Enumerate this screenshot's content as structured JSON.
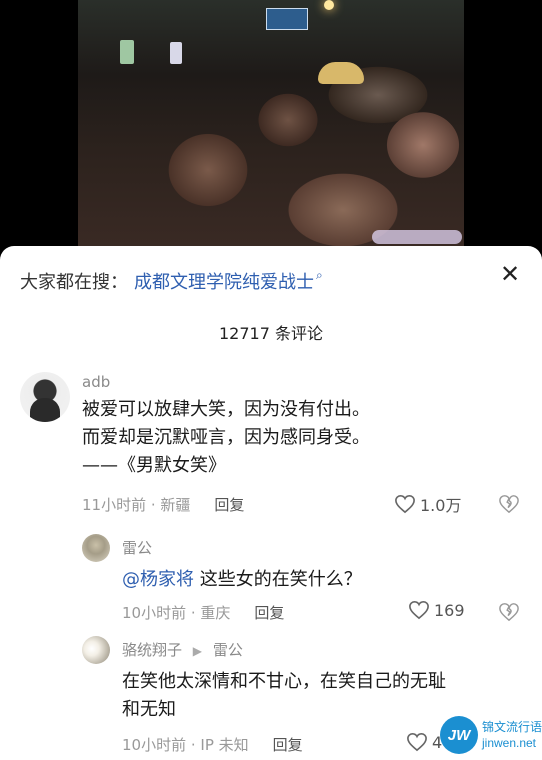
{
  "search": {
    "prefix": "大家都在搜：",
    "query": "成都文理学院纯爱战士",
    "icon": "search-icon"
  },
  "comments_count": "12717 条评论",
  "comments": [
    {
      "username": "adb",
      "lines": [
        "被爱可以放肆大笑，因为没有付出。",
        "而爱却是沉默哑言，因为感同身受。",
        "——《男默女笑》"
      ],
      "time_location": "11小时前 · 新疆",
      "reply_label": "回复",
      "likes": "1.0万"
    }
  ],
  "replies": [
    {
      "username": "雷公",
      "mention": "@杨家将",
      "text": "这些女的在笑什么？",
      "time_location": "10小时前 · 重庆",
      "reply_label": "回复",
      "likes": "169"
    },
    {
      "username": "骆统翔子",
      "reply_to": "雷公",
      "lines": [
        "在笑他太深情和不甘心，在笑自己的无耻",
        "和无知"
      ],
      "time_location": "10小时前 · IP 未知",
      "reply_label": "回复",
      "likes": "46"
    }
  ],
  "watermark": {
    "logo": "JW",
    "cn": "锦文流行语",
    "url": "jinwen.net"
  },
  "colors": {
    "link": "#2f5fb0",
    "meta": "#999999",
    "watermark": "#1b8fd1"
  }
}
